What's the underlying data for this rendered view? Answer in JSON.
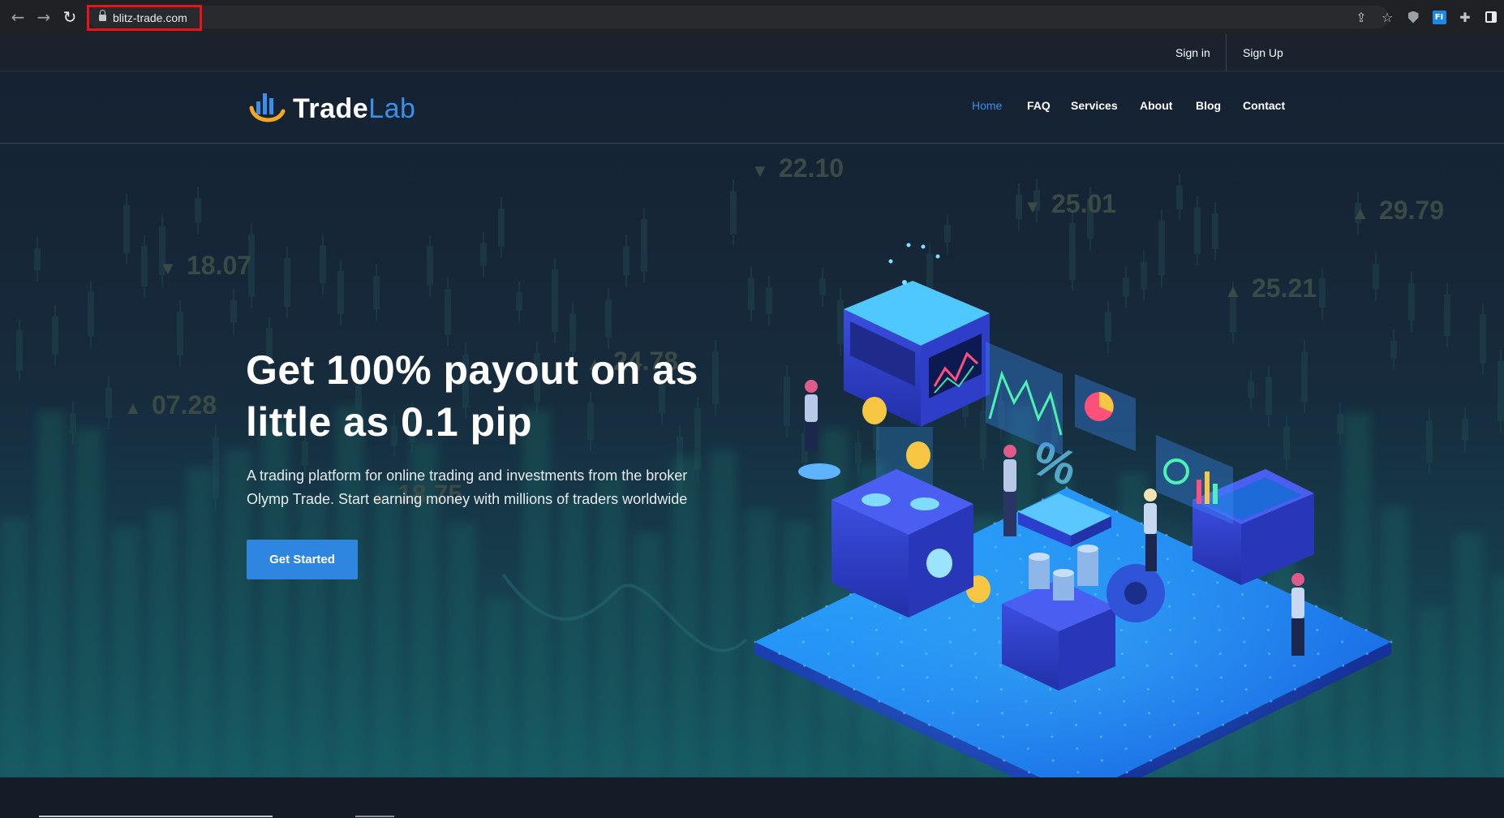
{
  "browser": {
    "url": "blitz-trade.com",
    "highlight_color": "#e8141a"
  },
  "topbar": {
    "signin_label": "Sign in",
    "signup_label": "Sign Up"
  },
  "brand": {
    "name_part1": "Trade",
    "name_part2": "Lab",
    "accent": "#3b8fe8",
    "logo_accent": "#f5a623"
  },
  "nav": {
    "items": [
      {
        "label": "Home",
        "active": true
      },
      {
        "label": "FAQ"
      },
      {
        "label": "Services"
      },
      {
        "label": "About"
      },
      {
        "label": "Blog"
      },
      {
        "label": "Contact"
      }
    ]
  },
  "hero": {
    "headline_line1": "Get 100% payout on as",
    "headline_line2": "little as 0.1 pip",
    "subtitle_line1": "A trading platform for online trading and investments from the broker",
    "subtitle_line2": "Olymp Trade. Start earning money with millions of traders worldwide",
    "cta_label": "Get Started",
    "cta_color": "#2f86e0"
  },
  "background_tickers": [
    {
      "direction": "down",
      "value": "22.10"
    },
    {
      "direction": "down",
      "value": "25.01"
    },
    {
      "direction": "up",
      "value": "29.79"
    },
    {
      "direction": "down",
      "value": "18.07"
    },
    {
      "direction": "up",
      "value": "25.21"
    },
    {
      "direction": "up",
      "value": "24.78"
    },
    {
      "direction": "up",
      "value": "07.28"
    },
    {
      "direction": "up",
      "value": "18.75"
    }
  ]
}
